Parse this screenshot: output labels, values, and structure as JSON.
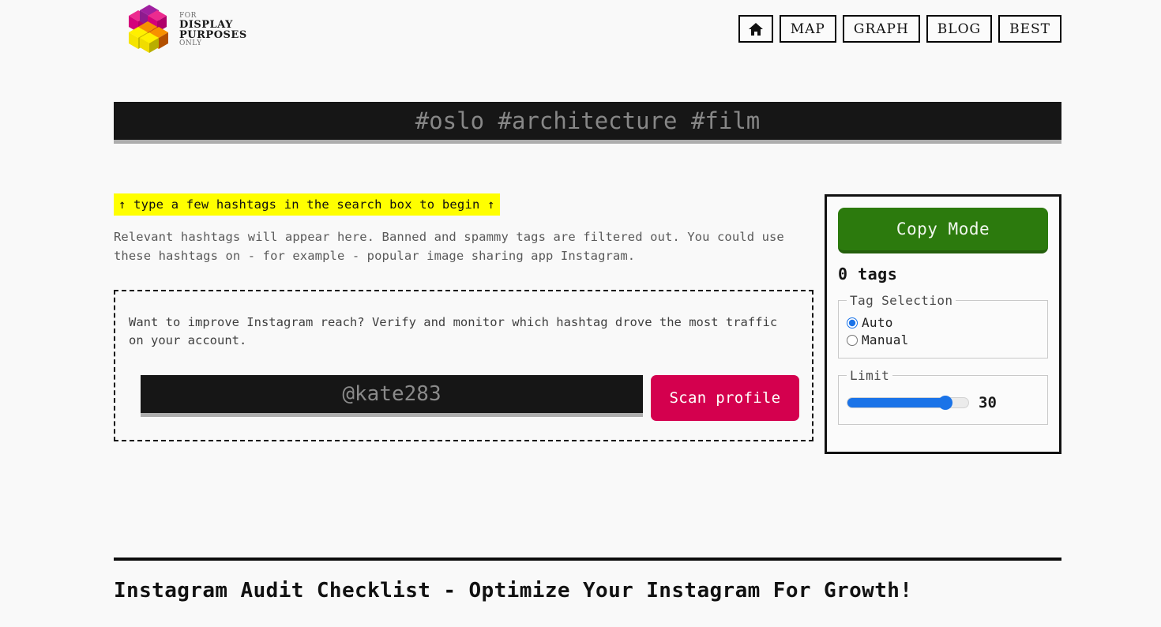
{
  "brand": {
    "logo_icon": "isometric-cubes-logo",
    "line1": "FOR",
    "line2": "DISPLAY",
    "line3": "PURPOSES",
    "line4": "ONLY",
    "colors": {
      "magenta": "#e6007e",
      "purple": "#8e1b8e",
      "orange": "#f07c00",
      "yellow": "#f5e400"
    }
  },
  "nav": {
    "home_icon": "home-icon",
    "items": [
      {
        "label": "MAP"
      },
      {
        "label": "GRAPH"
      },
      {
        "label": "BLOG"
      },
      {
        "label": "BEST"
      }
    ]
  },
  "search": {
    "value": "",
    "placeholder": "#oslo #architecture #film"
  },
  "main": {
    "hint": "↑ type a few hashtags in the search box to begin ↑",
    "blurb": "Relevant hashtags will appear here. Banned and spammy tags are filtered out. You could use these hashtags on - for example - popular image sharing app Instagram.",
    "promo": {
      "text": "Want to improve Instagram reach? Verify and monitor which hashtag drove the most traffic on your account.",
      "handle_value": "",
      "handle_placeholder": "@kate283",
      "scan_label": "Scan profile",
      "scan_color": "#d4004e"
    }
  },
  "panel": {
    "copy_mode_label": "Copy Mode",
    "copy_mode_color": "#2c7a0d",
    "tag_count": "0 tags",
    "tag_selection": {
      "legend": "Tag Selection",
      "options": [
        {
          "label": "Auto",
          "checked": true
        },
        {
          "label": "Manual",
          "checked": false
        }
      ]
    },
    "limit": {
      "legend": "Limit",
      "value": "30",
      "min": "1",
      "max": "35",
      "accent": "#1a73e8"
    }
  },
  "footer": {
    "heading": "Instagram Audit Checklist - Optimize Your Instagram For Growth!"
  }
}
